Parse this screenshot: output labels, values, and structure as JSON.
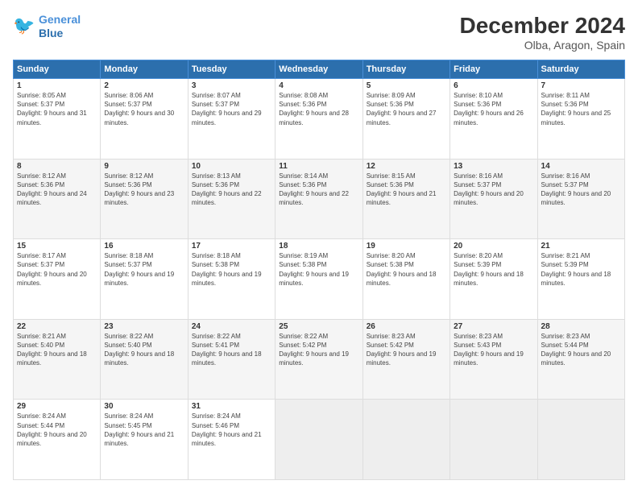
{
  "logo": {
    "line1": "General",
    "line2": "Blue"
  },
  "title": "December 2024",
  "location": "Olba, Aragon, Spain",
  "days_of_week": [
    "Sunday",
    "Monday",
    "Tuesday",
    "Wednesday",
    "Thursday",
    "Friday",
    "Saturday"
  ],
  "weeks": [
    [
      {
        "day": "1",
        "sunrise": "Sunrise: 8:05 AM",
        "sunset": "Sunset: 5:37 PM",
        "daylight": "Daylight: 9 hours and 31 minutes."
      },
      {
        "day": "2",
        "sunrise": "Sunrise: 8:06 AM",
        "sunset": "Sunset: 5:37 PM",
        "daylight": "Daylight: 9 hours and 30 minutes."
      },
      {
        "day": "3",
        "sunrise": "Sunrise: 8:07 AM",
        "sunset": "Sunset: 5:37 PM",
        "daylight": "Daylight: 9 hours and 29 minutes."
      },
      {
        "day": "4",
        "sunrise": "Sunrise: 8:08 AM",
        "sunset": "Sunset: 5:36 PM",
        "daylight": "Daylight: 9 hours and 28 minutes."
      },
      {
        "day": "5",
        "sunrise": "Sunrise: 8:09 AM",
        "sunset": "Sunset: 5:36 PM",
        "daylight": "Daylight: 9 hours and 27 minutes."
      },
      {
        "day": "6",
        "sunrise": "Sunrise: 8:10 AM",
        "sunset": "Sunset: 5:36 PM",
        "daylight": "Daylight: 9 hours and 26 minutes."
      },
      {
        "day": "7",
        "sunrise": "Sunrise: 8:11 AM",
        "sunset": "Sunset: 5:36 PM",
        "daylight": "Daylight: 9 hours and 25 minutes."
      }
    ],
    [
      {
        "day": "8",
        "sunrise": "Sunrise: 8:12 AM",
        "sunset": "Sunset: 5:36 PM",
        "daylight": "Daylight: 9 hours and 24 minutes."
      },
      {
        "day": "9",
        "sunrise": "Sunrise: 8:12 AM",
        "sunset": "Sunset: 5:36 PM",
        "daylight": "Daylight: 9 hours and 23 minutes."
      },
      {
        "day": "10",
        "sunrise": "Sunrise: 8:13 AM",
        "sunset": "Sunset: 5:36 PM",
        "daylight": "Daylight: 9 hours and 22 minutes."
      },
      {
        "day": "11",
        "sunrise": "Sunrise: 8:14 AM",
        "sunset": "Sunset: 5:36 PM",
        "daylight": "Daylight: 9 hours and 22 minutes."
      },
      {
        "day": "12",
        "sunrise": "Sunrise: 8:15 AM",
        "sunset": "Sunset: 5:36 PM",
        "daylight": "Daylight: 9 hours and 21 minutes."
      },
      {
        "day": "13",
        "sunrise": "Sunrise: 8:16 AM",
        "sunset": "Sunset: 5:37 PM",
        "daylight": "Daylight: 9 hours and 20 minutes."
      },
      {
        "day": "14",
        "sunrise": "Sunrise: 8:16 AM",
        "sunset": "Sunset: 5:37 PM",
        "daylight": "Daylight: 9 hours and 20 minutes."
      }
    ],
    [
      {
        "day": "15",
        "sunrise": "Sunrise: 8:17 AM",
        "sunset": "Sunset: 5:37 PM",
        "daylight": "Daylight: 9 hours and 20 minutes."
      },
      {
        "day": "16",
        "sunrise": "Sunrise: 8:18 AM",
        "sunset": "Sunset: 5:37 PM",
        "daylight": "Daylight: 9 hours and 19 minutes."
      },
      {
        "day": "17",
        "sunrise": "Sunrise: 8:18 AM",
        "sunset": "Sunset: 5:38 PM",
        "daylight": "Daylight: 9 hours and 19 minutes."
      },
      {
        "day": "18",
        "sunrise": "Sunrise: 8:19 AM",
        "sunset": "Sunset: 5:38 PM",
        "daylight": "Daylight: 9 hours and 19 minutes."
      },
      {
        "day": "19",
        "sunrise": "Sunrise: 8:20 AM",
        "sunset": "Sunset: 5:38 PM",
        "daylight": "Daylight: 9 hours and 18 minutes."
      },
      {
        "day": "20",
        "sunrise": "Sunrise: 8:20 AM",
        "sunset": "Sunset: 5:39 PM",
        "daylight": "Daylight: 9 hours and 18 minutes."
      },
      {
        "day": "21",
        "sunrise": "Sunrise: 8:21 AM",
        "sunset": "Sunset: 5:39 PM",
        "daylight": "Daylight: 9 hours and 18 minutes."
      }
    ],
    [
      {
        "day": "22",
        "sunrise": "Sunrise: 8:21 AM",
        "sunset": "Sunset: 5:40 PM",
        "daylight": "Daylight: 9 hours and 18 minutes."
      },
      {
        "day": "23",
        "sunrise": "Sunrise: 8:22 AM",
        "sunset": "Sunset: 5:40 PM",
        "daylight": "Daylight: 9 hours and 18 minutes."
      },
      {
        "day": "24",
        "sunrise": "Sunrise: 8:22 AM",
        "sunset": "Sunset: 5:41 PM",
        "daylight": "Daylight: 9 hours and 18 minutes."
      },
      {
        "day": "25",
        "sunrise": "Sunrise: 8:22 AM",
        "sunset": "Sunset: 5:42 PM",
        "daylight": "Daylight: 9 hours and 19 minutes."
      },
      {
        "day": "26",
        "sunrise": "Sunrise: 8:23 AM",
        "sunset": "Sunset: 5:42 PM",
        "daylight": "Daylight: 9 hours and 19 minutes."
      },
      {
        "day": "27",
        "sunrise": "Sunrise: 8:23 AM",
        "sunset": "Sunset: 5:43 PM",
        "daylight": "Daylight: 9 hours and 19 minutes."
      },
      {
        "day": "28",
        "sunrise": "Sunrise: 8:23 AM",
        "sunset": "Sunset: 5:44 PM",
        "daylight": "Daylight: 9 hours and 20 minutes."
      }
    ],
    [
      {
        "day": "29",
        "sunrise": "Sunrise: 8:24 AM",
        "sunset": "Sunset: 5:44 PM",
        "daylight": "Daylight: 9 hours and 20 minutes."
      },
      {
        "day": "30",
        "sunrise": "Sunrise: 8:24 AM",
        "sunset": "Sunset: 5:45 PM",
        "daylight": "Daylight: 9 hours and 21 minutes."
      },
      {
        "day": "31",
        "sunrise": "Sunrise: 8:24 AM",
        "sunset": "Sunset: 5:46 PM",
        "daylight": "Daylight: 9 hours and 21 minutes."
      },
      null,
      null,
      null,
      null
    ]
  ]
}
